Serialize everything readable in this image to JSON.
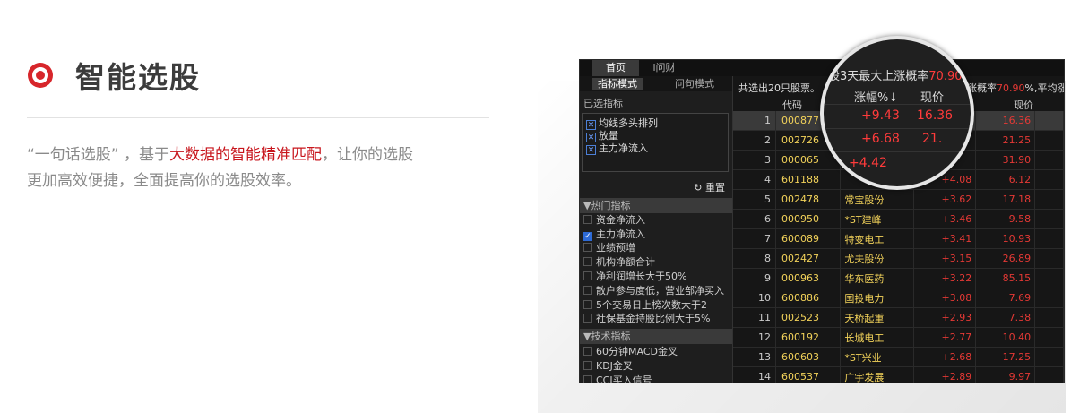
{
  "hero": {
    "title": "智能选股",
    "desc_part1": "“一句话选股” ，基于",
    "desc_highlight": "大数据的智能精准匹配",
    "desc_part2": "，让你的选股",
    "desc_line2": "更加高效便捷，全面提高你的选股效率。"
  },
  "colors": {
    "accent": "#d7262b",
    "up_red": "#e53935",
    "code_yellow": "#f2d25a"
  },
  "app": {
    "tabs": [
      "首页",
      "i问财"
    ],
    "modes": [
      "指标模式",
      "问句模式"
    ],
    "selected_label": "已选指标",
    "selected_items": [
      "均线多头排列",
      "放量",
      "主力净流入"
    ],
    "reset_label": "重置",
    "hot_section": "▼热门指标",
    "hot_items": [
      {
        "label": "资金净流入",
        "checked": false
      },
      {
        "label": "主力净流入",
        "checked": true
      },
      {
        "label": "业绩预增",
        "checked": false
      },
      {
        "label": "机构净额合计",
        "checked": false
      },
      {
        "label": "净利润增长大于50%",
        "checked": false
      },
      {
        "label": "散户参与度低，营业部净买入",
        "checked": false
      },
      {
        "label": "5个交易日上榜次数大于2",
        "checked": false
      },
      {
        "label": "社保基金持股比例大于5%",
        "checked": false
      }
    ],
    "tech_section": "▼技术指标",
    "tech_items": [
      {
        "label": "60分钟MACD金叉",
        "checked": false
      },
      {
        "label": "KDJ金叉",
        "checked": false
      },
      {
        "label": "CCI买入信号",
        "checked": false
      }
    ],
    "summary_prefix": "共选出20只股票。",
    "summary_tail_prefix": "上涨概率",
    "summary_tail_rate": "70.90",
    "summary_tail_suffix": "%,平均涨幅",
    "headers": {
      "code": "代码",
      "price": "现价"
    },
    "rows": [
      {
        "idx": "1",
        "code": "000877",
        "name": "",
        "chg": "",
        "price": "16.36"
      },
      {
        "idx": "2",
        "code": "002726",
        "name": "",
        "chg": "",
        "price": "21.25"
      },
      {
        "idx": "3",
        "code": "000065",
        "name": "",
        "chg": "",
        "price": "31.90"
      },
      {
        "idx": "4",
        "code": "601188",
        "name": "",
        "chg": "+4.08",
        "price": "6.12"
      },
      {
        "idx": "5",
        "code": "002478",
        "name": "常宝股份",
        "chg": "+3.62",
        "price": "17.18"
      },
      {
        "idx": "6",
        "code": "000950",
        "name": "*ST建峰",
        "chg": "+3.46",
        "price": "9.58"
      },
      {
        "idx": "7",
        "code": "600089",
        "name": "特变电工",
        "chg": "+3.41",
        "price": "10.93"
      },
      {
        "idx": "8",
        "code": "002427",
        "name": "尤夫股份",
        "chg": "+3.15",
        "price": "26.89"
      },
      {
        "idx": "9",
        "code": "000963",
        "name": "华东医药",
        "chg": "+3.22",
        "price": "85.15"
      },
      {
        "idx": "10",
        "code": "600886",
        "name": "国投电力",
        "chg": "+3.08",
        "price": "7.69"
      },
      {
        "idx": "11",
        "code": "002523",
        "name": "天桥起重",
        "chg": "+2.93",
        "price": "7.38"
      },
      {
        "idx": "12",
        "code": "600192",
        "name": "长城电工",
        "chg": "+2.77",
        "price": "10.40"
      },
      {
        "idx": "13",
        "code": "600603",
        "name": "*ST兴业",
        "chg": "+2.68",
        "price": "17.25"
      },
      {
        "idx": "14",
        "code": "600537",
        "name": "广宇发展",
        "chg": "+2.89",
        "price": "9.97"
      }
    ]
  },
  "lens": {
    "summary_prefix": "持股3天最大上涨概率",
    "summary_rate": "70.90",
    "summary_suffix": "%,",
    "col_chg": "涨幅%↓",
    "col_price": "现价",
    "row2_chg": "+9.43",
    "row2_price": "16.36",
    "row3_chg": "+6.68",
    "row3_price": "21.",
    "row4_chg": "+4.42"
  }
}
